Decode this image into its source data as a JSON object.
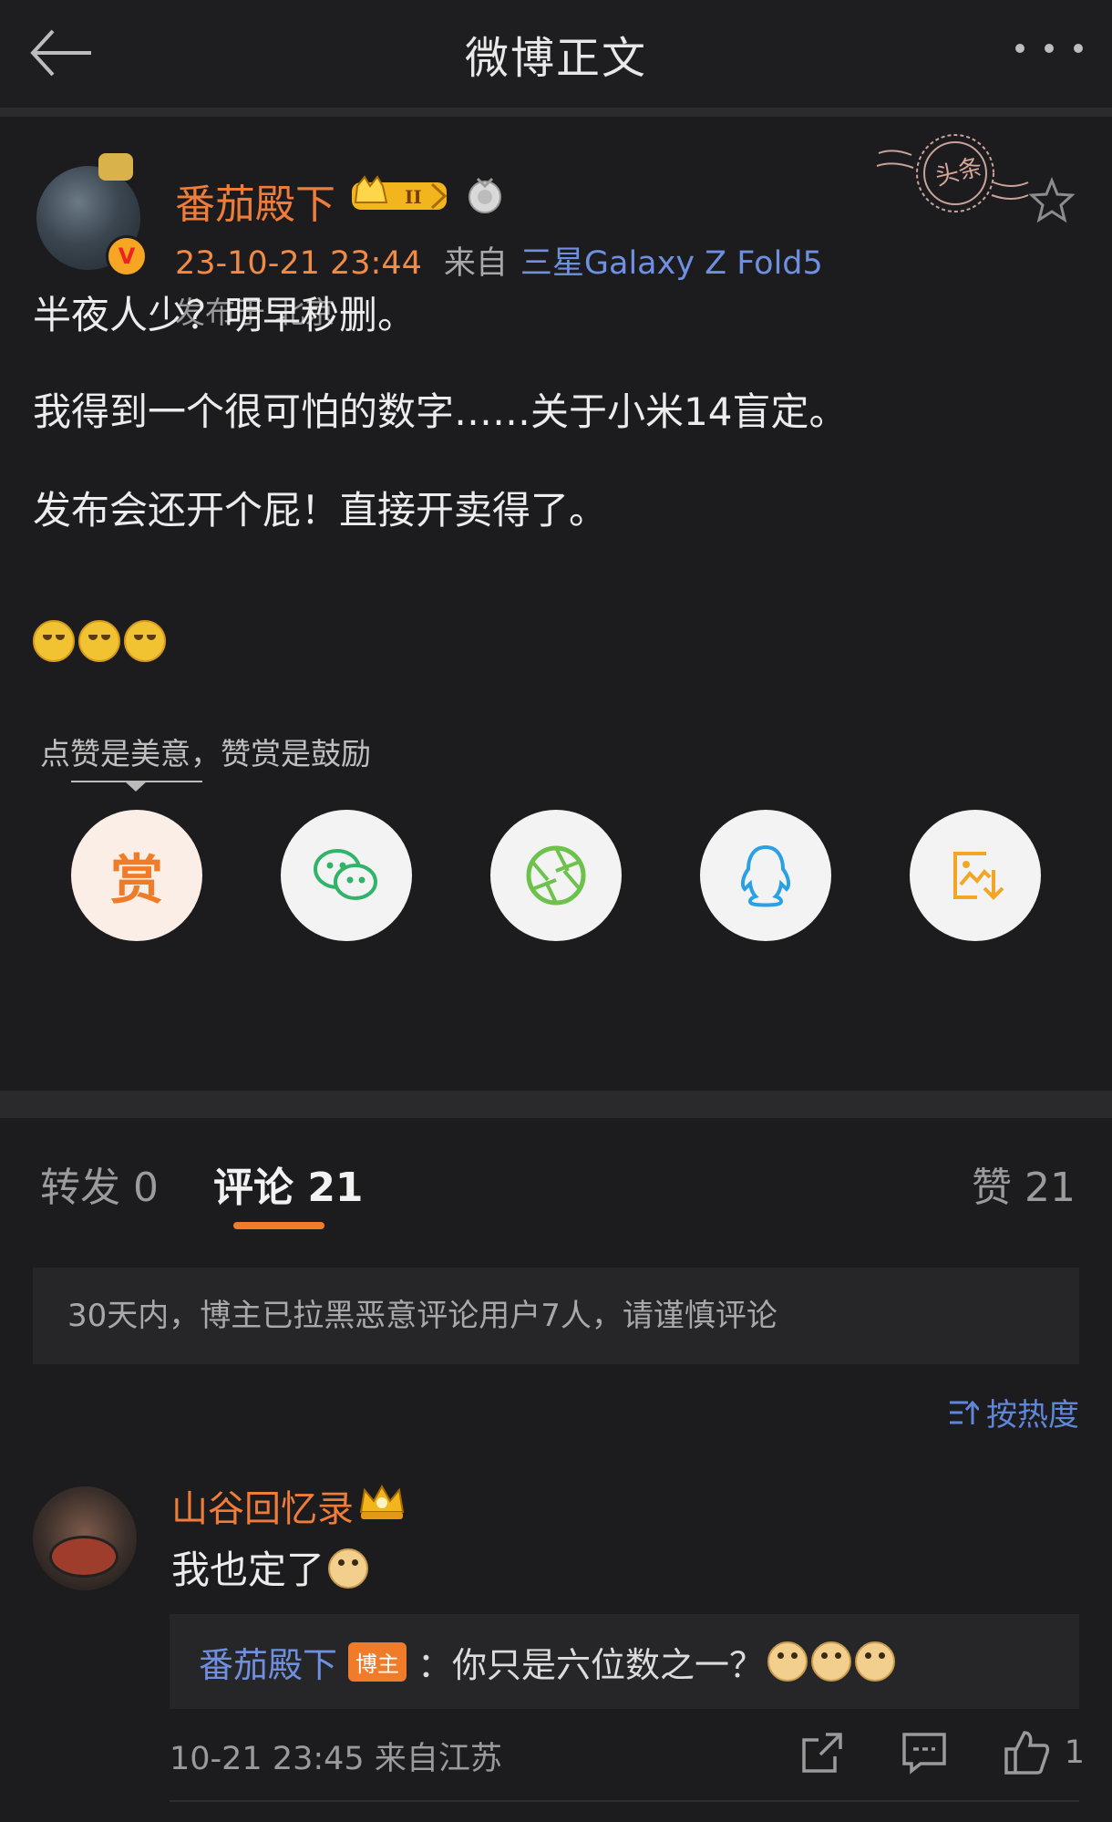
{
  "header": {
    "title": "微博正文",
    "back_icon": "back-arrow-icon",
    "more_icon": "more-dots-icon"
  },
  "post": {
    "author": "番茄殿下",
    "datetime": "23-10-21 23:44",
    "source_label": "来自",
    "device": "三星Galaxy Z Fold5",
    "location": "发布于 北京",
    "paragraphs": [
      "半夜人少？明早秒删。",
      "我得到一个很可怕的数字……关于小米14盲定。",
      "发布会还开个屁！直接开卖得了。"
    ],
    "stamp_text": "头条",
    "tip_label": "点赞是美意，赞赏是鼓励",
    "reward_label": "赏",
    "share_targets": [
      "reward",
      "wechat",
      "moments",
      "qq",
      "save-image"
    ]
  },
  "tabs": {
    "repost": "转发 0",
    "comment": "评论 21",
    "like": "赞 21"
  },
  "notice": "30天内，博主已拉黑恶意评论用户7人，请谨慎评论",
  "sort_label": "按热度",
  "comment": {
    "user": "山谷回忆录",
    "text": "我也定了",
    "reply_user": "番茄殿下",
    "reply_badge": "博主",
    "reply_text": "：你只是六位数之一？",
    "time_location": "10-21 23:45 来自江苏",
    "like_count": "1"
  },
  "colors": {
    "accent": "#f07c2a",
    "link": "#6f8fe0",
    "background": "#1c1c1e"
  }
}
